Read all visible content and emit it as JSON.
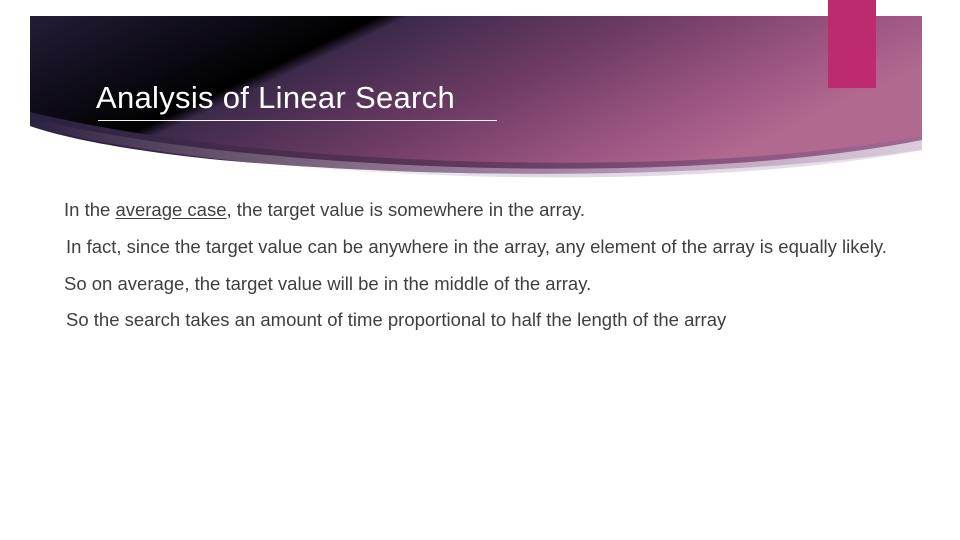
{
  "slide": {
    "title": "Analysis of Linear Search",
    "accent_color": "#bd2a6e",
    "banner_color_dark": "#2b2342",
    "banner_color_mid": "#6b3a63",
    "banner_color_light": "#a05a87",
    "body": {
      "line1_a": "In the ",
      "line1_b": "average case",
      "line1_c": ", the target value is somewhere in the array.",
      "line2": "In fact, since the target value can be anywhere in the array, any element of the array is equally likely.",
      "line3": "So on average, the target value will be in the middle of the array.",
      "line4": "So the search takes an amount of time proportional to half the length of the array"
    }
  }
}
